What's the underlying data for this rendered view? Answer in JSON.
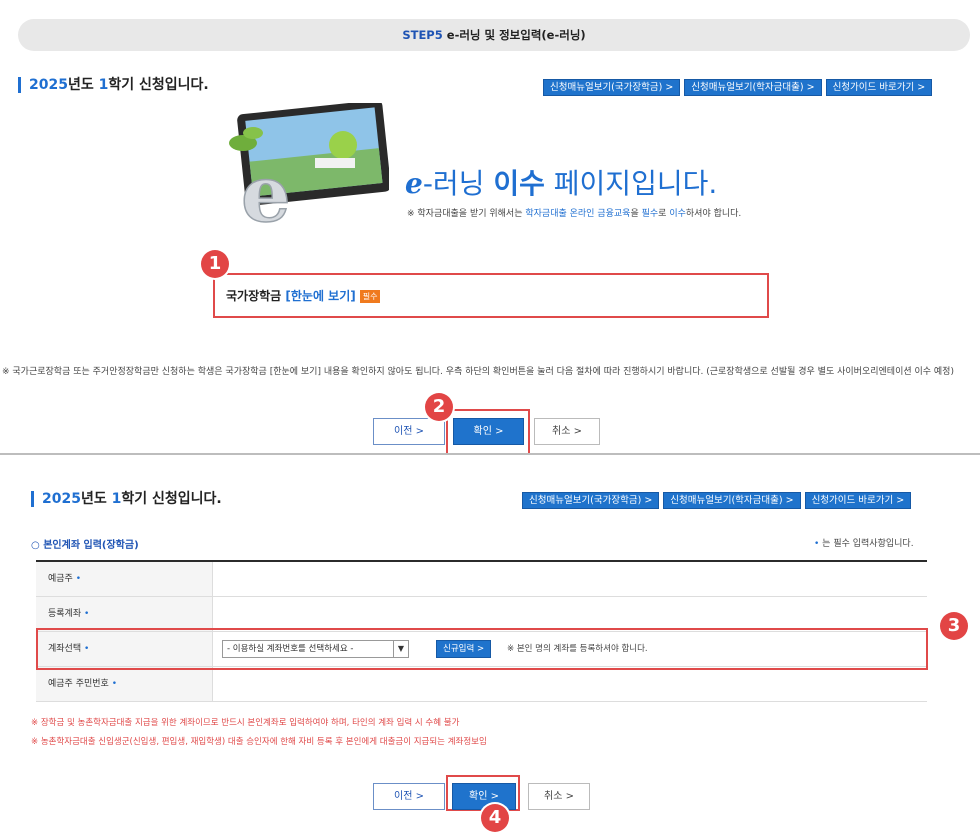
{
  "step": {
    "label": "STEP5",
    "title": "e-러닝 및 정보입력(e-러닝)"
  },
  "semester": {
    "year": "2025",
    "mid": "년도 ",
    "term": "1",
    "rest": "학기 신청입니다."
  },
  "top_buttons": [
    "신청매뉴얼보기(국가장학금) >",
    "신청매뉴얼보기(학자금대출) >",
    "신청가이드 바로가기 >"
  ],
  "hero": {
    "e": "e",
    "title_dash": "-러닝 ",
    "title_bold": "이수",
    "title_rest": " 페이지입니다.",
    "note_a": "※ 학자금대출을 받기 위해서는 ",
    "note_hl": "학자금대출 온라인 금융교육",
    "note_b": "을 ",
    "note_req": "필수",
    "note_c": "로 ",
    "note_done": "이수",
    "note_d": "하셔야 합니다."
  },
  "ns_item": {
    "label": "국가장학금 ",
    "link": "[한눈에 보기]",
    "badge": "필수"
  },
  "notice": "※ 국가근로장학금 또는 주거안정장학금만 신청하는 학생은 국가장학금 [한눈에 보기] 내용을 확인하지 않아도 됩니다. 우측 하단의 확인버튼을 눌러 다음 절차에 따라 진행하시기 바랍니다. (근로장학생으로 선발될 경우 별도 사이버오리엔테이션 이수 예정)",
  "nav1": {
    "prev": "이전 >",
    "ok": "확인 >",
    "cancel": "취소 >"
  },
  "nav2": {
    "prev": "이전 >",
    "ok": "확인 >",
    "cancel": "취소 >"
  },
  "form": {
    "section": "본인계좌 입력(장학금)",
    "req_dot": "•",
    "req_note": " 는 필수 입력사항입니다.",
    "rows": [
      {
        "label": "예금주",
        "star": "•"
      },
      {
        "label": "등록계좌",
        "star": "•"
      },
      {
        "label": "계좌선택",
        "star": "•"
      },
      {
        "label": "예금주 주민번호",
        "star": "•"
      }
    ],
    "select_value": "- 이용하실 계좌번호를 선택하세요 -",
    "new_button": "신규입력 >",
    "acc_note": "※ 본인 명의 계좌를 등록하셔야 합니다.",
    "warn1": "※ 장학금 및 농촌학자금대출 지급을 위한 계좌이므로 반드시 본인계좌로 입력하여야 하며, 타인의 계좌 입력 시 수혜 불가",
    "warn2": "※ 농촌학자금대출 신입생군(신입생, 편입생, 재입학생) 대출 승인자에 한해 자비 등록 후 본인에게 대출금이 지급되는 계좌정보임"
  },
  "markers": [
    "1",
    "2",
    "3",
    "4"
  ],
  "colors": {
    "accent": "#1f73cc",
    "highlight_frame": "#e04a4a",
    "badge": "#f07a1e"
  }
}
